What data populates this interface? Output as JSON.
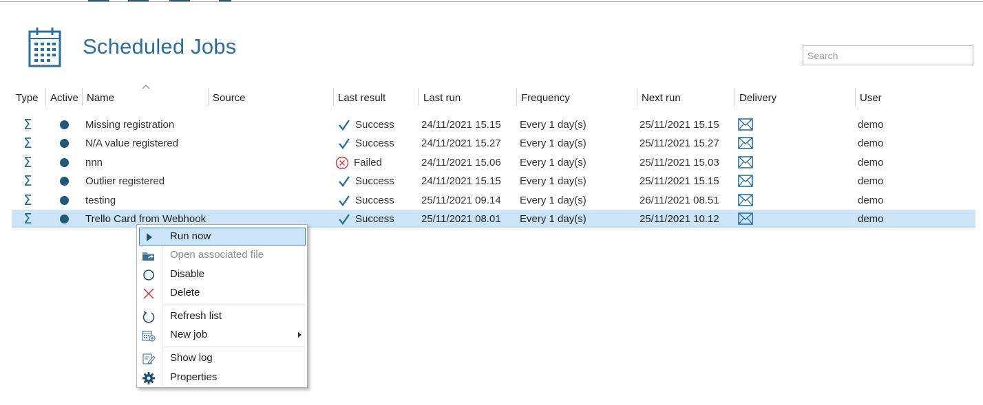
{
  "page": {
    "title": "Scheduled Jobs"
  },
  "search": {
    "placeholder": "Search",
    "value": ""
  },
  "columns": {
    "type": "Type",
    "active": "Active",
    "name": "Name",
    "source": "Source",
    "last_result": "Last result",
    "last_run": "Last run",
    "frequency": "Frequency",
    "next_run": "Next run",
    "delivery": "Delivery",
    "user": "User"
  },
  "jobs": [
    {
      "type_icon": "sigma-icon",
      "active": true,
      "name": "Missing registration",
      "source": "",
      "result": "Success",
      "result_icon": "check-icon",
      "last_run": "24/11/2021  15.15",
      "frequency": "Every 1 day(s)",
      "next_run": "25/11/2021  15.15",
      "delivery_icon": "mail-icon",
      "user": "demo"
    },
    {
      "type_icon": "sigma-icon",
      "active": true,
      "name": "N/A value registered",
      "source": "",
      "result": "Success",
      "result_icon": "check-icon",
      "last_run": "24/11/2021  15.27",
      "frequency": "Every 1 day(s)",
      "next_run": "25/11/2021  15.27",
      "delivery_icon": "mail-icon",
      "user": "demo"
    },
    {
      "type_icon": "sigma-icon",
      "active": true,
      "name": "nnn",
      "source": "",
      "result": "Failed",
      "result_icon": "failed-icon",
      "last_run": "24/11/2021  15.06",
      "frequency": "Every 1 day(s)",
      "next_run": "25/11/2021  15.03",
      "delivery_icon": "mail-icon",
      "user": "demo"
    },
    {
      "type_icon": "sigma-icon",
      "active": true,
      "name": "Outlier registered",
      "source": "",
      "result": "Success",
      "result_icon": "check-icon",
      "last_run": "24/11/2021  15.15",
      "frequency": "Every 1 day(s)",
      "next_run": "25/11/2021  15.15",
      "delivery_icon": "mail-icon",
      "user": "demo"
    },
    {
      "type_icon": "sigma-icon",
      "active": true,
      "name": "testing",
      "source": "",
      "result": "Success",
      "result_icon": "check-icon",
      "last_run": "25/11/2021  09.14",
      "frequency": "Every 1 day(s)",
      "next_run": "26/11/2021  08.51",
      "delivery_icon": "mail-icon",
      "user": "demo"
    },
    {
      "type_icon": "sigma-icon",
      "active": true,
      "name": "Trello Card from Webhook",
      "source": "",
      "result": "Success",
      "result_icon": "check-icon",
      "last_run": "25/11/2021  08.01",
      "frequency": "Every 1 day(s)",
      "next_run": "25/11/2021  10.12",
      "delivery_icon": "mail-icon",
      "user": "demo",
      "selected": true
    }
  ],
  "context_menu": {
    "items": [
      {
        "label": "Run now",
        "icon": "play-icon",
        "highlighted": true
      },
      {
        "label": "Open associated file",
        "icon": "open-folder-icon",
        "disabled": true
      },
      {
        "label": "Disable",
        "icon": "circle-icon"
      },
      {
        "label": "Delete",
        "icon": "delete-x-icon"
      },
      {
        "label": "Refresh list",
        "icon": "refresh-icon"
      },
      {
        "label": "New job",
        "icon": "new-job-icon",
        "submenu": true
      },
      {
        "label": "Show log",
        "icon": "log-icon"
      },
      {
        "label": "Properties",
        "icon": "gear-icon"
      }
    ]
  },
  "colors": {
    "accent": "#2a6f9b",
    "dot": "#1f5a7d",
    "selection": "#cce4f7",
    "failed": "#d13438"
  }
}
